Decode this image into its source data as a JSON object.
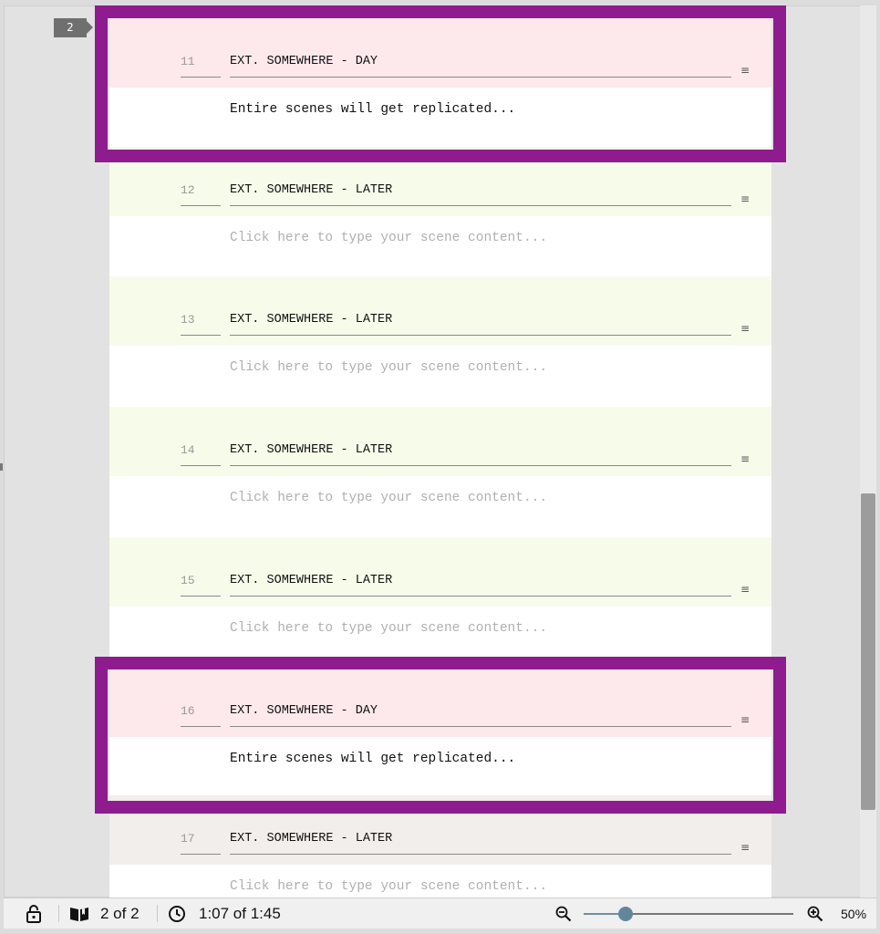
{
  "page_badge": "2",
  "scenes": [
    {
      "number": "11",
      "heading": "EXT. SOMEWHERE - DAY",
      "content": "Entire scenes will get replicated...",
      "content_state": "filled",
      "color": "#fde8ec",
      "menu_icon": "hamburger-icon"
    },
    {
      "number": "12",
      "heading": "EXT. SOMEWHERE - LATER",
      "content": "Click here to type your scene content...",
      "content_state": "placeholder",
      "color": "#f7fbea",
      "menu_icon": "hamburger-icon"
    },
    {
      "number": "13",
      "heading": "EXT. SOMEWHERE - LATER",
      "content": "Click here to type your scene content...",
      "content_state": "placeholder",
      "color": "#f7fbea",
      "menu_icon": "hamburger-icon"
    },
    {
      "number": "14",
      "heading": "EXT. SOMEWHERE - LATER",
      "content": "Click here to type your scene content...",
      "content_state": "placeholder",
      "color": "#f7fbea",
      "menu_icon": "hamburger-icon"
    },
    {
      "number": "15",
      "heading": "EXT. SOMEWHERE - LATER",
      "content": "Click here to type your scene content...",
      "content_state": "placeholder",
      "color": "#f7fbea",
      "menu_icon": "hamburger-icon"
    },
    {
      "number": "16",
      "heading": "EXT. SOMEWHERE - DAY",
      "content": "Entire scenes will get replicated...",
      "content_state": "filled",
      "color": "#fde8ec",
      "menu_icon": "hamburger-icon"
    },
    {
      "number": "17",
      "heading": "EXT. SOMEWHERE - LATER",
      "content": "Click here to type your scene content...",
      "content_state": "placeholder",
      "color": "#f2eeec",
      "menu_icon": "hamburger-icon"
    }
  ],
  "highlight_color": "#8e1c8e",
  "status_bar": {
    "lock_icon": "lock-icon",
    "pages_icon": "book-icon",
    "pages": "2 of 2",
    "clock_icon": "clock-icon",
    "time": "1:07 of 1:45",
    "zoom_out_icon": "zoom-out-icon",
    "zoom_in_icon": "zoom-in-icon",
    "zoom_slider_fraction": 0.2,
    "zoom": "50%"
  }
}
